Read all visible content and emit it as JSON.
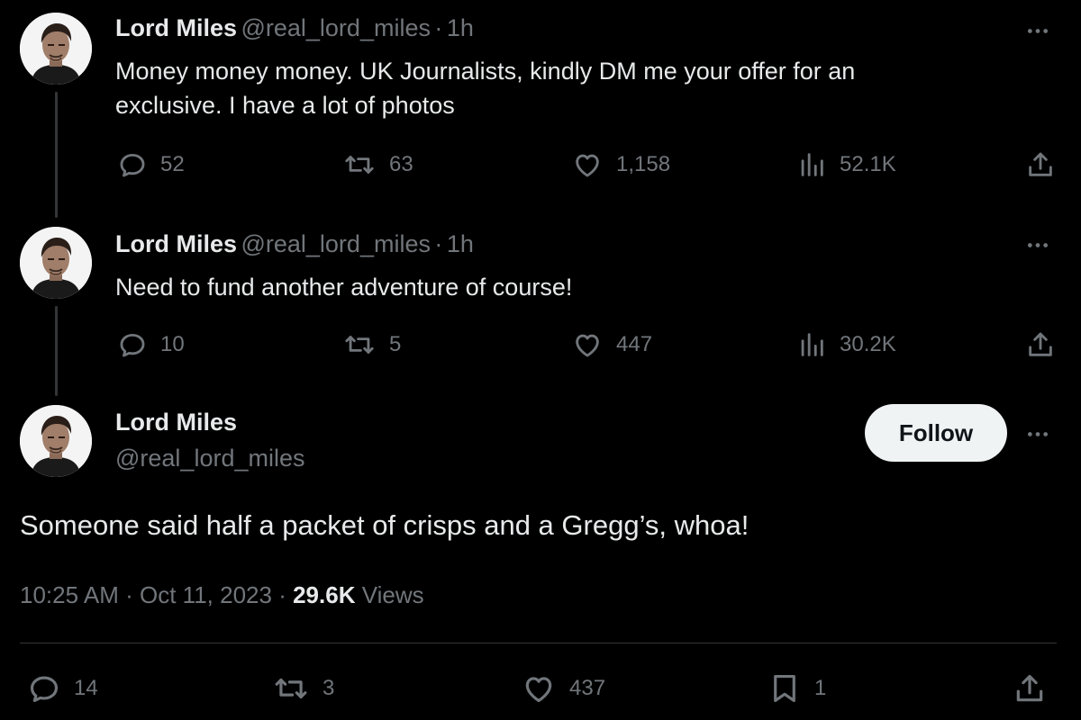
{
  "tweets": [
    {
      "name": "Lord Miles",
      "handle": "@real_lord_miles",
      "sep": "·",
      "time": "1h",
      "text_line1": "Money money money. UK Journalists, kindly DM me your offer for an",
      "text_line2": "exclusive. I have a lot of photos",
      "replies": "52",
      "reposts": "63",
      "likes": "1,158",
      "views": "52.1K"
    },
    {
      "name": "Lord Miles",
      "handle": "@real_lord_miles",
      "sep": "·",
      "time": "1h",
      "text_line1": "Need to fund another adventure of course!",
      "replies": "10",
      "reposts": "5",
      "likes": "447",
      "views": "30.2K"
    }
  ],
  "main_tweet": {
    "name": "Lord Miles",
    "handle": "@real_lord_miles",
    "follow_label": "Follow",
    "text": "Someone said half a packet of crisps and a Gregg’s, whoa!",
    "time": "10:25 AM",
    "sep1": "·",
    "date": "Oct 11, 2023",
    "sep2": "·",
    "views_count": "29.6K",
    "views_label": "Views",
    "replies": "14",
    "reposts": "3",
    "likes": "437",
    "bookmarks": "1"
  },
  "icons": {
    "reply": "reply-icon",
    "repost": "repost-icon",
    "like": "heart-icon",
    "views": "views-icon",
    "share": "share-icon",
    "bookmark": "bookmark-icon",
    "more": "more-icon"
  },
  "colors": {
    "background": "#000000",
    "text_primary": "#e7e9ea",
    "text_secondary": "#71767b",
    "follow_bg": "#eff3f4"
  }
}
